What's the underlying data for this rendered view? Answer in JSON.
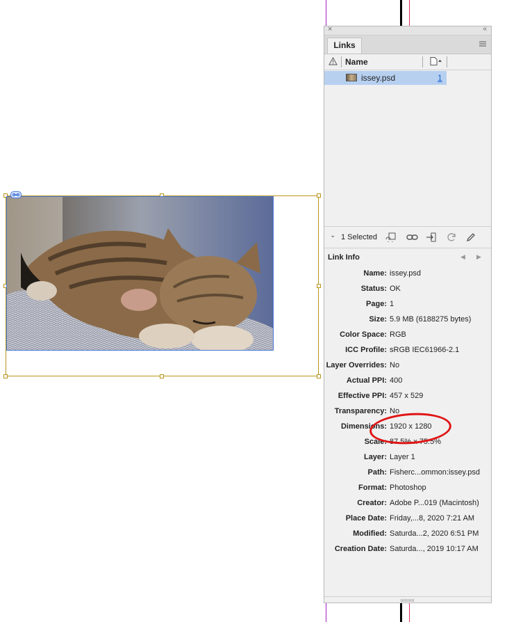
{
  "panel": {
    "close_glyph": "×",
    "collapse_glyph": "‹‹",
    "tab_label": "Links",
    "column_name": "Name",
    "link_row": {
      "filename": "issey.psd",
      "page": "1"
    },
    "selection_status": "1 Selected",
    "info_title": "Link Info",
    "info": [
      {
        "key": "Name:",
        "value": "issey.psd"
      },
      {
        "key": "Status:",
        "value": "OK"
      },
      {
        "key": "Page:",
        "value": "1"
      },
      {
        "key": "Size:",
        "value": "5.9 MB (6188275 bytes)"
      },
      {
        "key": "Color Space:",
        "value": "RGB"
      },
      {
        "key": "ICC Profile:",
        "value": "sRGB IEC61966-2.1"
      },
      {
        "key": "Layer Overrides:",
        "value": "No"
      },
      {
        "key": "Actual PPI:",
        "value": "400"
      },
      {
        "key": "Effective PPI:",
        "value": "457 x 529"
      },
      {
        "key": "Transparency:",
        "value": "No"
      },
      {
        "key": "Dimensions:",
        "value": "1920 x 1280"
      },
      {
        "key": "Scale:",
        "value": "87.5% x 75.5%"
      },
      {
        "key": "Layer:",
        "value": "Layer 1"
      },
      {
        "key": "Path:",
        "value": "Fisherc...ommon:issey.psd"
      },
      {
        "key": "Format:",
        "value": "Photoshop"
      },
      {
        "key": "Creator:",
        "value": "Adobe P...019 (Macintosh)"
      },
      {
        "key": "Place Date:",
        "value": "Friday,...8, 2020 7:21 AM"
      },
      {
        "key": "Modified:",
        "value": "Saturda...2, 2020 6:51 PM"
      },
      {
        "key": "Creation Date:",
        "value": "Saturda..., 2019 10:17 AM"
      }
    ]
  },
  "toolbar_icons": [
    "relink-from-folder-icon",
    "relink-icon",
    "go-to-link-icon",
    "update-link-icon",
    "edit-original-icon"
  ],
  "colors": {
    "frame": "#b8941c",
    "selection_blue": "#b7d0f0",
    "highlight_circle": "#e01515"
  }
}
